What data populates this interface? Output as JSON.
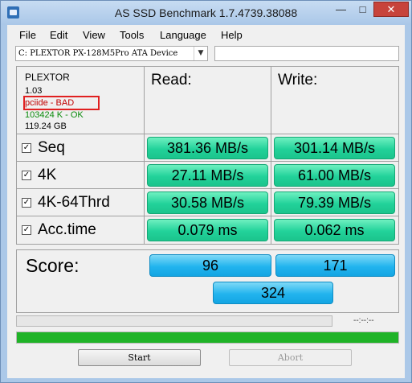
{
  "window": {
    "title": "AS SSD Benchmark 1.7.4739.38088"
  },
  "menu": [
    "File",
    "Edit",
    "View",
    "Tools",
    "Language",
    "Help"
  ],
  "drive_select": {
    "value": "C: PLEXTOR PX-128M5Pro ATA Device"
  },
  "info": {
    "model": "PLEXTOR",
    "firmware": "1.03",
    "driver": "pciide - BAD",
    "alignment": "103424 K - OK",
    "size": "119.24 GB",
    "colors": {
      "bad": "#c00000",
      "ok": "#0b8a0b"
    }
  },
  "columns": {
    "read": "Read:",
    "write": "Write:"
  },
  "rows": [
    {
      "label": "Seq",
      "checked": true,
      "read": "381.36 MB/s",
      "write": "301.14 MB/s"
    },
    {
      "label": "4K",
      "checked": true,
      "read": "27.11 MB/s",
      "write": "61.00 MB/s"
    },
    {
      "label": "4K-64Thrd",
      "checked": true,
      "read": "30.58 MB/s",
      "write": "79.39 MB/s"
    },
    {
      "label": "Acc.time",
      "checked": true,
      "read": "0.079 ms",
      "write": "0.062 ms"
    }
  ],
  "score": {
    "label": "Score:",
    "read": "96",
    "write": "171",
    "total": "324"
  },
  "progress": {
    "elapsed": "--:--:--",
    "bar1_fraction": 0,
    "bar2_fraction": 1.0
  },
  "buttons": {
    "start": "Start",
    "abort": "Abort"
  },
  "colors": {
    "result_green": "#22d29a",
    "score_blue": "#22b4ee",
    "progress_green": "#1fb327"
  }
}
